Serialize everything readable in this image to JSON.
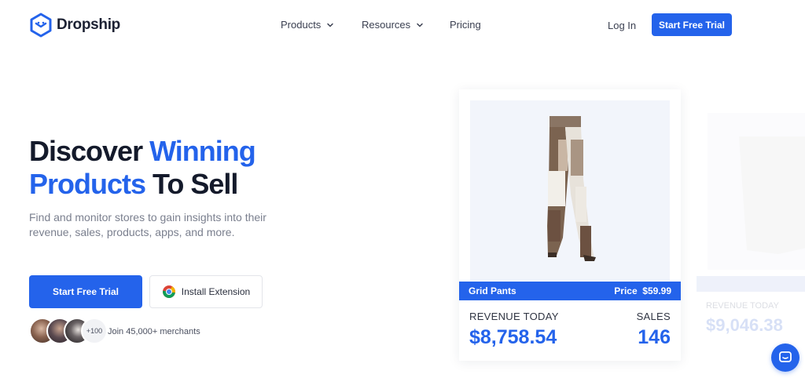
{
  "brand": {
    "name": "Dropship",
    "color": "#2463eb"
  },
  "nav": {
    "products": "Products",
    "resources": "Resources",
    "pricing": "Pricing",
    "login": "Log In",
    "cta": "Start Free Trial"
  },
  "hero": {
    "title_part1": "Discover ",
    "title_highlight1": "Winning",
    "title_highlight2": "Products",
    "title_part2": " To Sell",
    "subtitle": "Find and monitor stores to gain insights into their revenue, sales, products, apps, and more.",
    "primary_button": "Start Free Trial",
    "extension_button": "Install Extension",
    "avatar_count": "+100",
    "merchants_text": "Join 45,000+ merchants"
  },
  "product_card": {
    "name": "Grid Pants",
    "price_label": "Price",
    "price": "$59.99",
    "revenue_label": "REVENUE TODAY",
    "revenue": "$8,758.54",
    "sales_label": "SALES",
    "sales": "146"
  },
  "product_card_2": {
    "revenue_label": "REVENUE TODAY",
    "revenue": "$9,046.38"
  },
  "icons": [
    "logo-icon",
    "chevron-down-icon",
    "chrome-icon",
    "chat-icon"
  ]
}
